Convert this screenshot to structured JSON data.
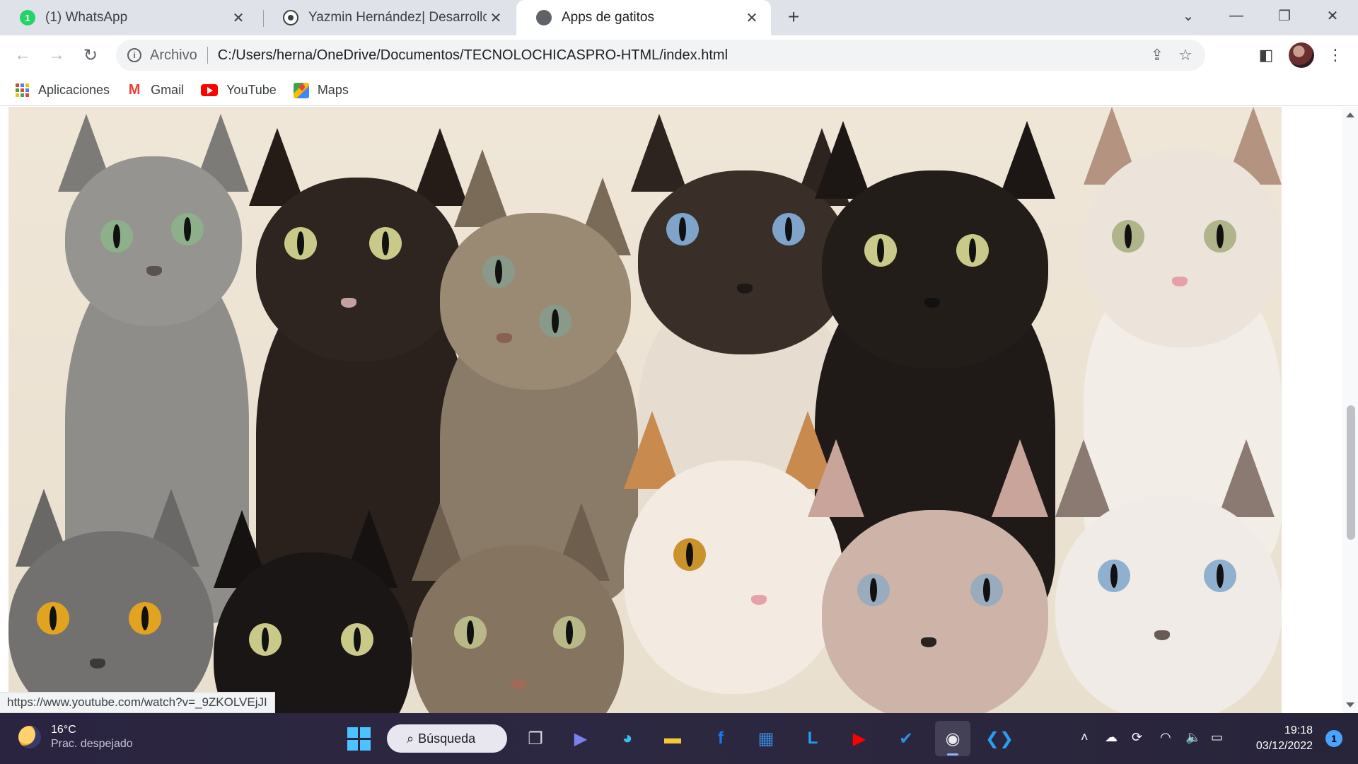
{
  "tabs": [
    {
      "title": "(1) WhatsApp",
      "badge": "1",
      "active": false
    },
    {
      "title": "Yazmin Hernández| Desarrollo W",
      "active": false
    },
    {
      "title": "Apps de gatitos",
      "active": true
    }
  ],
  "toolbar": {
    "site_chip": "Archivo",
    "url": "C:/Users/herna/OneDrive/Documentos/TECNOLOCHICASPRO-HTML/index.html"
  },
  "bookmarks": [
    {
      "label": "Aplicaciones",
      "icon": "apps-grid-icon"
    },
    {
      "label": "Gmail",
      "icon": "gmail-icon"
    },
    {
      "label": "YouTube",
      "icon": "youtube-icon"
    },
    {
      "label": "Maps",
      "icon": "maps-icon"
    }
  ],
  "status_url": "https://www.youtube.com/watch?v=_9ZKOLVEjJI",
  "taskbar": {
    "weather_temp": "16°C",
    "weather_cond": "Prac. despejado",
    "search_label": "Búsqueda",
    "time": "19:18",
    "date": "03/12/2022",
    "notifications": "1"
  },
  "colors": {
    "tabstrip": "#dfe3e9",
    "accent": "#4cc2ff",
    "youtube": "#ff0000"
  }
}
